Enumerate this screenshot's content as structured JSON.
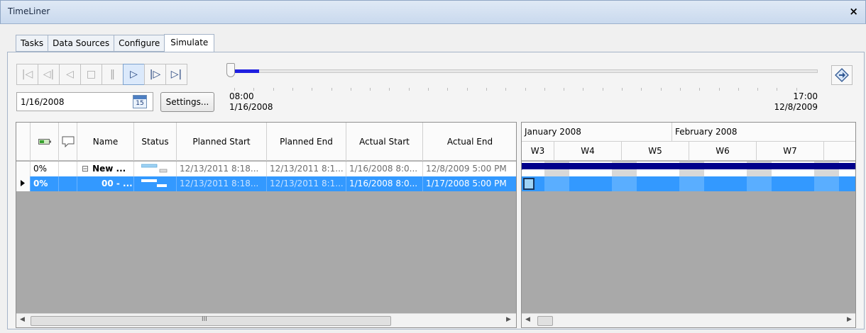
{
  "window": {
    "title": "TimeLiner",
    "close_glyph": "×"
  },
  "tabs": [
    {
      "label": "Tasks",
      "active": false
    },
    {
      "label": "Data Sources",
      "active": false
    },
    {
      "label": "Configure",
      "active": false
    },
    {
      "label": "Simulate",
      "active": true
    }
  ],
  "playback": {
    "buttons": [
      {
        "name": "go-to-start-icon",
        "glyph": "|◁",
        "enabled": false
      },
      {
        "name": "step-back-icon",
        "glyph": "◁|",
        "enabled": false
      },
      {
        "name": "play-reverse-icon",
        "glyph": "◁",
        "enabled": false
      },
      {
        "name": "stop-icon",
        "glyph": "□",
        "enabled": false
      },
      {
        "name": "pause-icon",
        "glyph": "‖",
        "enabled": false
      },
      {
        "name": "play-icon",
        "glyph": "▷",
        "enabled": true,
        "pressed": true
      },
      {
        "name": "step-forward-icon",
        "glyph": "|▷",
        "enabled": true
      },
      {
        "name": "go-to-end-icon",
        "glyph": "▷|",
        "enabled": true
      }
    ],
    "slider_progress": 0.05
  },
  "current_date": "1/16/2008",
  "calendar_icon_text": "15",
  "settings_label": "Settings...",
  "range_start": {
    "time": "08:00",
    "date": "1/16/2008"
  },
  "range_end": {
    "time": "17:00",
    "date": "12/8/2009"
  },
  "grid": {
    "columns": [
      "",
      "",
      "Name",
      "Status",
      "Planned Start",
      "Planned End",
      "Actual Start",
      "Actual End"
    ],
    "rows": [
      {
        "progress": "0%",
        "expander": "⊟",
        "name": "New ...",
        "planned_start": "12/13/2011 8:18...",
        "planned_end": "12/13/2011 8:1...",
        "actual_start": "1/16/2008 8:0...",
        "actual_end": "12/8/2009 5:00 PM",
        "selected": false
      },
      {
        "progress": "0%",
        "name": "00 - ...",
        "planned_start": "12/13/2011 8:18...",
        "planned_end": "12/13/2011 8:1...",
        "actual_start": "1/16/2008 8:0...",
        "actual_end": "1/17/2008 5:00 PM",
        "selected": true
      }
    ],
    "scroll_marker": "III"
  },
  "gantt": {
    "months": [
      "January 2008",
      "February 2008"
    ],
    "weeks": [
      "W3",
      "W4",
      "W5",
      "W6",
      "W7"
    ],
    "colors": {
      "summary_bar": "#00008b",
      "selection": "#3399ff"
    }
  }
}
